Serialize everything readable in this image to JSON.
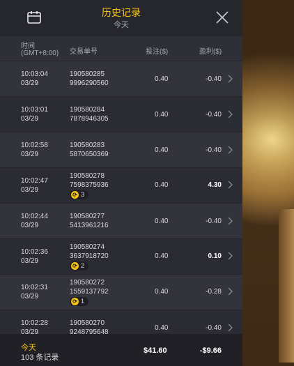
{
  "header": {
    "title": "历史记录",
    "subtitle": "今天"
  },
  "columns": {
    "time": "时间",
    "timezone": "(GMT+8:00)",
    "order": "交易单号",
    "bet": "投注($)",
    "profit": "盈利($)"
  },
  "rows": [
    {
      "time": "10:03:04",
      "date": "03/29",
      "order1": "190580285",
      "order2": "9996290560",
      "bet": "0.40",
      "profit": "-0.40",
      "win": false,
      "free": ""
    },
    {
      "time": "10:03:01",
      "date": "03/29",
      "order1": "190580284",
      "order2": "7878946305",
      "bet": "0.40",
      "profit": "-0.40",
      "win": false,
      "free": ""
    },
    {
      "time": "10:02:58",
      "date": "03/29",
      "order1": "190580283",
      "order2": "5870650369",
      "bet": "0.40",
      "profit": "-0.40",
      "win": false,
      "free": ""
    },
    {
      "time": "10:02:47",
      "date": "03/29",
      "order1": "190580278",
      "order2": "7598375936",
      "bet": "0.40",
      "profit": "4.30",
      "win": true,
      "free": "3"
    },
    {
      "time": "10:02:44",
      "date": "03/29",
      "order1": "190580277",
      "order2": "5413961216",
      "bet": "0.40",
      "profit": "-0.40",
      "win": false,
      "free": ""
    },
    {
      "time": "10:02:36",
      "date": "03/29",
      "order1": "190580274",
      "order2": "3637918720",
      "bet": "0.40",
      "profit": "0.10",
      "win": true,
      "free": "2"
    },
    {
      "time": "10:02:31",
      "date": "03/29",
      "order1": "190580272",
      "order2": "1559137792",
      "bet": "0.40",
      "profit": "-0.28",
      "win": false,
      "free": "1"
    },
    {
      "time": "10:02:28",
      "date": "03/29",
      "order1": "190580270",
      "order2": "9248795648",
      "bet": "0.40",
      "profit": "-0.40",
      "win": false,
      "free": ""
    }
  ],
  "footer": {
    "today": "今天",
    "count": "103 条记录",
    "total_bet": "$41.60",
    "total_profit": "-$9.66"
  },
  "colors": {
    "accent": "#f5c518",
    "panel": "#2b2b33"
  }
}
